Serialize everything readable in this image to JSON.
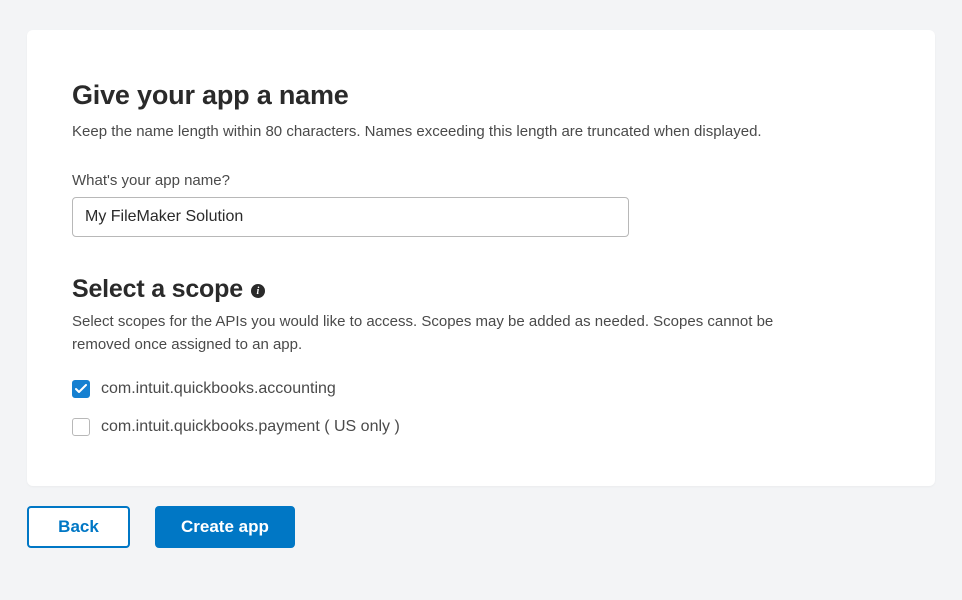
{
  "appName": {
    "title": "Give your app a name",
    "description": "Keep the name length within 80 characters. Names exceeding this length are truncated when displayed.",
    "fieldLabel": "What's your app name?",
    "value": "My FileMaker Solution"
  },
  "scope": {
    "title": "Select a scope",
    "description": "Select scopes for the APIs you would like to access. Scopes may be added as needed. Scopes cannot be removed once assigned to an app.",
    "options": [
      {
        "label": "com.intuit.quickbooks.accounting",
        "checked": true
      },
      {
        "label": "com.intuit.quickbooks.payment ( US only )",
        "checked": false
      }
    ]
  },
  "buttons": {
    "back": "Back",
    "create": "Create app"
  }
}
